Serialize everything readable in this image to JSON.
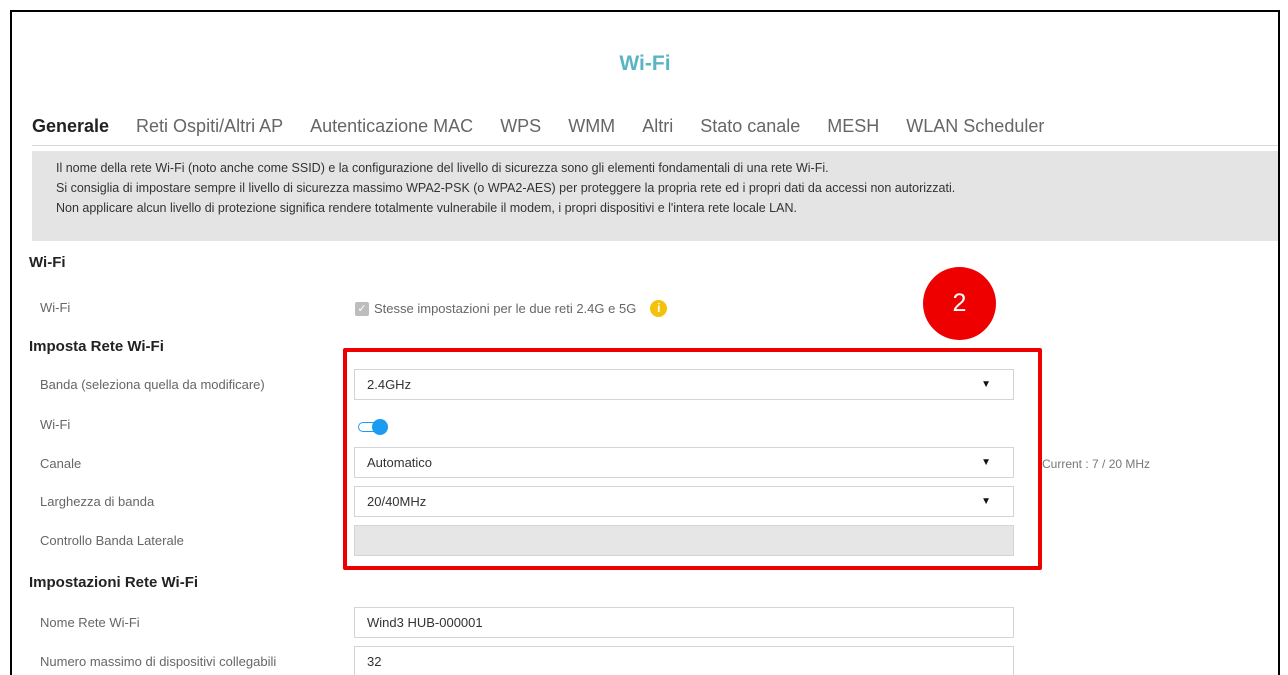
{
  "page_title": "Wi-Fi",
  "tabs": [
    {
      "label": "Generale",
      "active": true
    },
    {
      "label": "Reti Ospiti/Altri AP"
    },
    {
      "label": "Autenticazione MAC"
    },
    {
      "label": "WPS"
    },
    {
      "label": "WMM"
    },
    {
      "label": "Altri"
    },
    {
      "label": "Stato canale"
    },
    {
      "label": "MESH"
    },
    {
      "label": "WLAN Scheduler"
    }
  ],
  "info_lines": [
    "Il nome della rete Wi-Fi (noto anche come SSID) e la configurazione del livello di sicurezza sono gli elementi fondamentali di una rete Wi-Fi.",
    "Si consiglia di impostare sempre il livello di sicurezza massimo WPA2-PSK (o WPA2-AES) per proteggere la propria rete ed i propri dati da accessi non autorizzati.",
    "Non applicare alcun livello di protezione significa rendere totalmente vulnerabile il modem, i propri dispositivi e l'intera rete locale LAN."
  ],
  "wifi_section": {
    "title": "Wi-Fi",
    "row_label": "Wi-Fi",
    "checkbox_label": "Stesse impostazioni per le due reti 2.4G e 5G",
    "checked": true,
    "info_icon": "info-icon",
    "info_symbol": "i"
  },
  "imposta_section": {
    "title": "Imposta Rete Wi-Fi",
    "banda_label": "Banda (seleziona quella da modificare)",
    "banda_value": "2.4GHz",
    "wifi_label": "Wi-Fi",
    "wifi_on": true,
    "canale_label": "Canale",
    "canale_value": "Automatico",
    "canale_current": "Current : 7 / 20 MHz",
    "larghezza_label": "Larghezza di banda",
    "larghezza_value": "20/40MHz",
    "controllo_label": "Controllo Banda Laterale",
    "controllo_value": ""
  },
  "impostazioni_section": {
    "title": "Impostazioni Rete Wi-Fi",
    "nome_label": "Nome Rete Wi-Fi",
    "nome_value": "Wind3 HUB-000001",
    "max_label": "Numero massimo di dispositivi collegabili",
    "max_value": "32"
  },
  "annotation": {
    "badge_text": "2",
    "color": "#ee0000"
  },
  "dropdown_symbol": "▼",
  "check_symbol": "✓",
  "colors": {
    "accent": "#5ab4c4",
    "toggle": "#1a9cf0",
    "info_icon": "#f4c20d"
  }
}
